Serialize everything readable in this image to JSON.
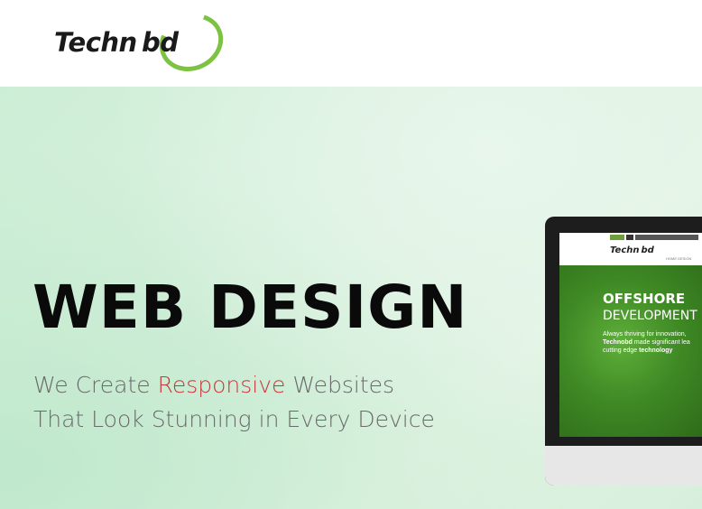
{
  "header": {
    "logo_text": "Techn bd"
  },
  "hero": {
    "title": "WEB DESIGN",
    "subtitle_line1_a": "We Create ",
    "subtitle_line1_accent": "Responsive",
    "subtitle_line1_b": " Websites",
    "subtitle_line2": "That Look Stunning in Every Device",
    "accent_color": "#c5393b"
  },
  "monitor": {
    "mini_logo": "Techn bd",
    "mini_nav": "HOME   DESIGN",
    "banner_title": "OFFSHORE",
    "banner_sub": "DEVELOPMENT",
    "banner_line1": "Always thriving for innovation,",
    "banner_line2_bold": "Technobd",
    "banner_line2": " made significant lea",
    "banner_line3": "cutting edge ",
    "banner_line3_bold": "technology"
  }
}
